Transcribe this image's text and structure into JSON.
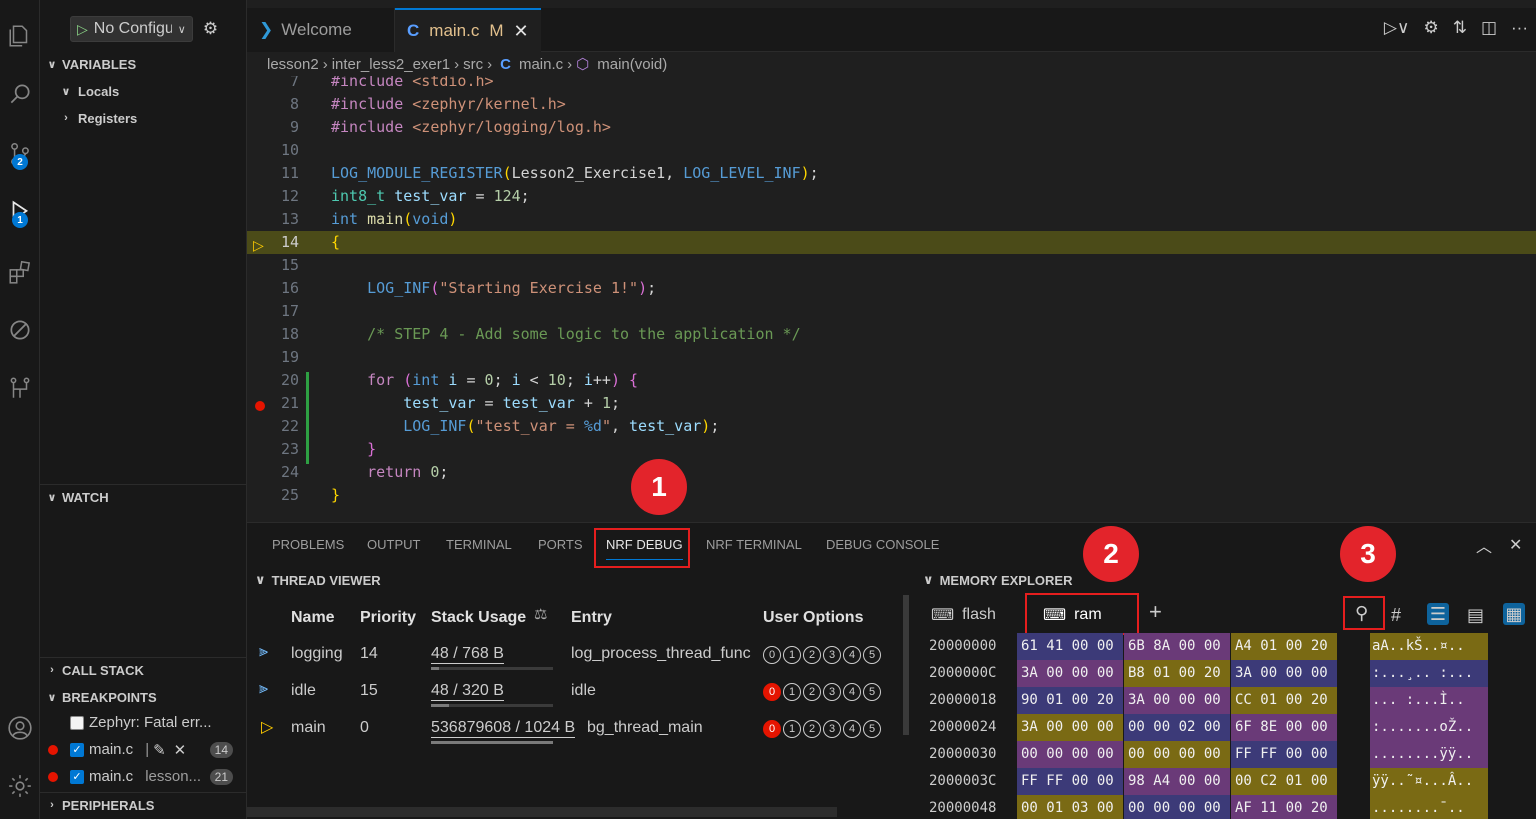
{
  "debug": {
    "config_label": "No Configu"
  },
  "sidebar": {
    "variables": "VARIABLES",
    "locals": "Locals",
    "registers": "Registers",
    "watch": "WATCH",
    "call_stack": "CALL STACK",
    "breakpoints": "BREAKPOINTS",
    "peripherals": "PERIPHERALS",
    "bp_items": [
      {
        "label": "Zephyr: Fatal err...",
        "checked": false
      },
      {
        "label": "main.c",
        "extra": "",
        "count": "14",
        "checked": true
      },
      {
        "label": "main.c",
        "extra": "lesson...",
        "count": "21",
        "checked": true
      }
    ]
  },
  "activity_badges": {
    "scm": "2",
    "run": "1"
  },
  "tabs": {
    "welcome": "Welcome",
    "main": "main.c",
    "main_mod": "M"
  },
  "breadcrumb": {
    "a": "lesson2",
    "b": "inter_less2_exer1",
    "c": "src",
    "file": "main.c",
    "fn": "main(void)"
  },
  "editor": {
    "lines": [
      "7",
      "8",
      "9",
      "10",
      "11",
      "12",
      "13",
      "14",
      "15",
      "16",
      "17",
      "18",
      "19",
      "20",
      "21",
      "22",
      "23",
      "24",
      "25"
    ]
  },
  "panel": {
    "tabs": [
      "PROBLEMS",
      "OUTPUT",
      "TERMINAL",
      "PORTS",
      "NRF DEBUG",
      "NRF TERMINAL",
      "DEBUG CONSOLE"
    ],
    "thread_viewer": "THREAD VIEWER",
    "memory_explorer": "MEMORY EXPLORER",
    "callouts": [
      "1",
      "2",
      "3"
    ]
  },
  "threads": {
    "headers": {
      "name": "Name",
      "priority": "Priority",
      "stack": "Stack Usage",
      "entry": "Entry",
      "options": "User Options"
    },
    "rows": [
      {
        "name": "logging",
        "priority": "14",
        "stack": "48 / 768 B",
        "stack_fraction": 0.0625,
        "entry": "log_process_thread_func"
      },
      {
        "name": "idle",
        "priority": "15",
        "stack": "48 / 320 B",
        "stack_fraction": 0.15,
        "entry": "idle"
      },
      {
        "name": "main",
        "priority": "0",
        "stack": "536879608 / 1024 B",
        "stack_fraction": 1.0,
        "entry": "bg_thread_main"
      }
    ]
  },
  "memory": {
    "tabs": {
      "flash": "flash",
      "ram": "ram"
    },
    "rows": [
      {
        "addr": "20000000",
        "w": [
          "61 41 00 00",
          "6B 8A 00 00",
          "A4 01 00 20"
        ],
        "ascii": "aA..kŠ..¤.. "
      },
      {
        "addr": "2000000C",
        "w": [
          "3A 00 00 00",
          "B8 01 00 20",
          "3A 00 00 00"
        ],
        "ascii": ":...¸.. :..."
      },
      {
        "addr": "20000018",
        "w": [
          "90 01 00 20",
          "3A 00 00 00",
          "CC 01 00 20"
        ],
        "ascii": "... :...Ì.. "
      },
      {
        "addr": "20000024",
        "w": [
          "3A 00 00 00",
          "00 00 02 00",
          "6F 8E 00 00"
        ],
        "ascii": ":.......oŽ.."
      },
      {
        "addr": "20000030",
        "w": [
          "00 00 00 00",
          "00 00 00 00",
          "FF FF 00 00"
        ],
        "ascii": "........ÿÿ.."
      },
      {
        "addr": "2000003C",
        "w": [
          "FF FF 00 00",
          "98 A4 00 00",
          "00 C2 01 00"
        ],
        "ascii": "ÿÿ..˜¤...Â.."
      },
      {
        "addr": "20000048",
        "w": [
          "00 01 03 00",
          "00 00 00 00",
          "AF 11 00 20"
        ],
        "ascii": "........¯.. "
      }
    ]
  }
}
